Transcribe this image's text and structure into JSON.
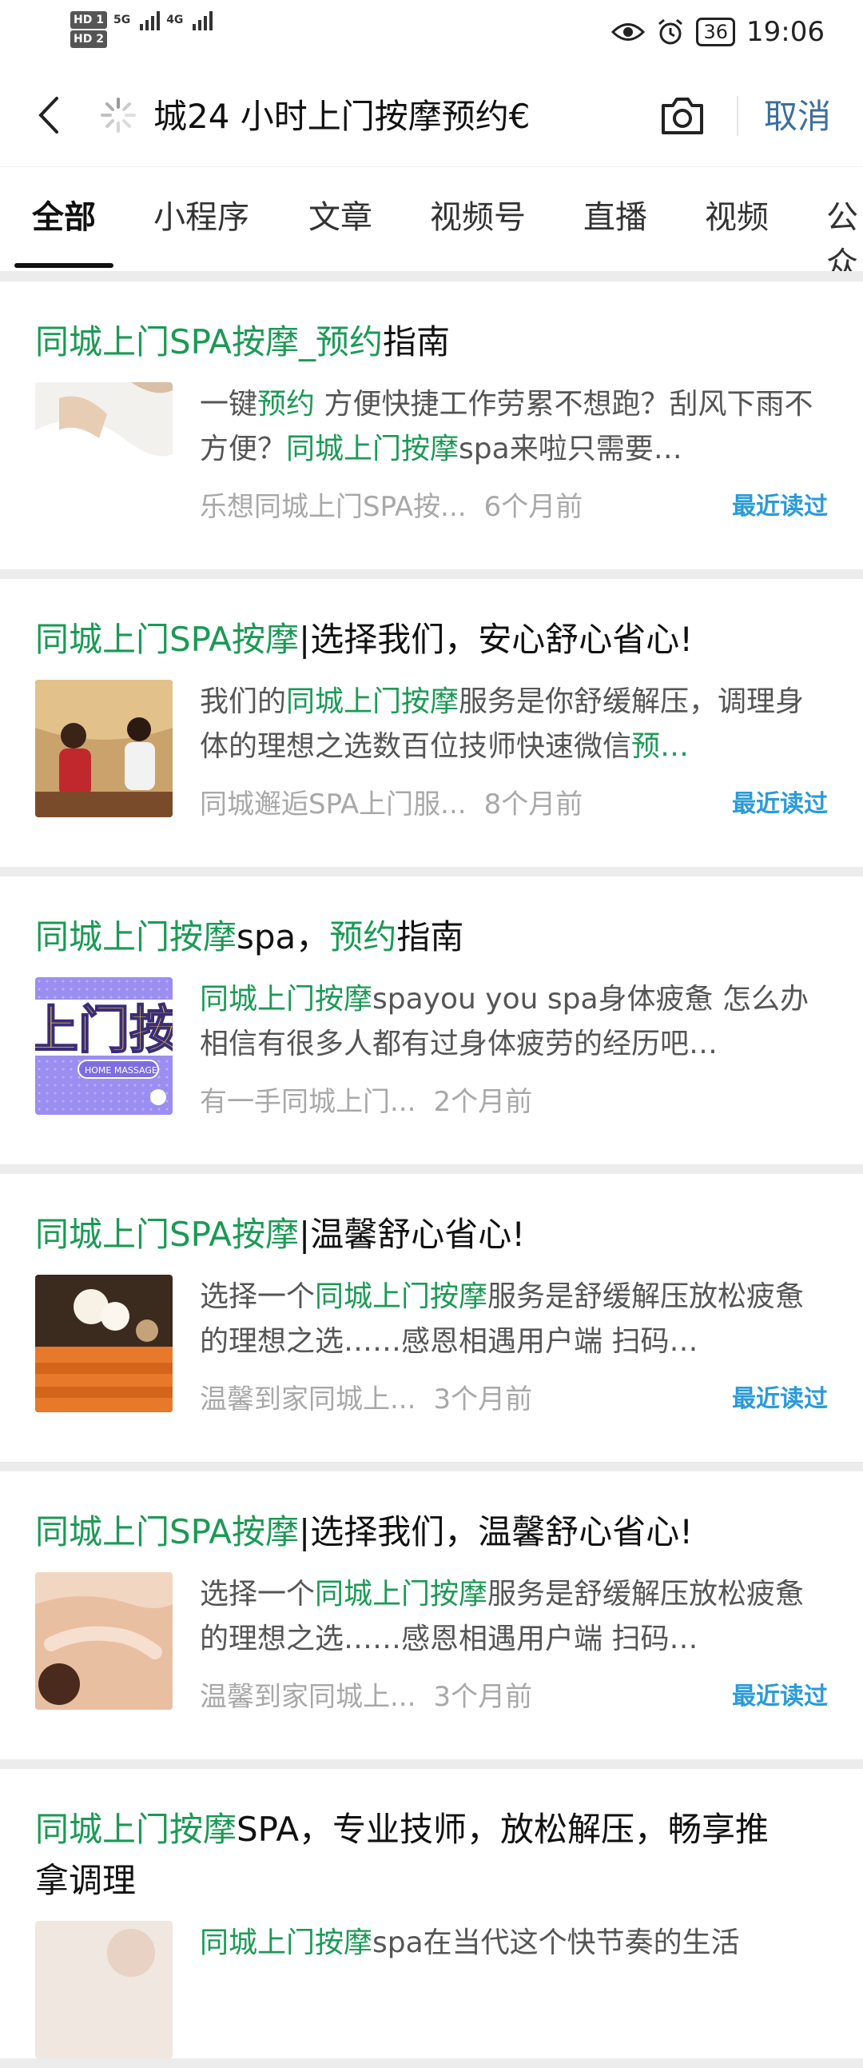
{
  "status": {
    "hd1": "HD 1",
    "hd2": "HD 2",
    "net5g": "5G",
    "net4g": "4G",
    "battery": "36",
    "time": "19:06"
  },
  "search": {
    "query": "城24 小时上门按摩预约€",
    "cancel_label": "取消"
  },
  "tabs": [
    "全部",
    "小程序",
    "文章",
    "视频号",
    "直播",
    "视频",
    "公众号"
  ],
  "recent_label": "最近读过",
  "results": [
    {
      "title": [
        {
          "t": "同城上门SPA按摩_预约",
          "hl": true
        },
        {
          "t": "指南",
          "hl": false
        }
      ],
      "snippet": [
        {
          "t": "一键",
          "hl": false
        },
        {
          "t": "预约",
          "hl": true
        },
        {
          "t": " 方便快捷工作劳累不想跑？刮风下雨不方便？",
          "hl": false
        },
        {
          "t": "同城上门按摩",
          "hl": true
        },
        {
          "t": "spa来啦只需要…",
          "hl": false
        }
      ],
      "source": "乐想同城上门SPA按...",
      "time": "6个月前",
      "recent": true
    },
    {
      "title": [
        {
          "t": "同城上门SPA按摩",
          "hl": true
        },
        {
          "t": "|选择我们，安心舒心省心!",
          "hl": false
        }
      ],
      "snippet": [
        {
          "t": "我们的",
          "hl": false
        },
        {
          "t": "同城上门按摩",
          "hl": true
        },
        {
          "t": "服务是你舒缓解压，调理身体的理想之选数百位技师快速微信",
          "hl": false
        },
        {
          "t": "预…",
          "hl": true
        }
      ],
      "source": "同城邂逅SPA上门服...",
      "time": "8个月前",
      "recent": true
    },
    {
      "title": [
        {
          "t": "同城上门按摩",
          "hl": true
        },
        {
          "t": "spa，",
          "hl": false
        },
        {
          "t": "预约",
          "hl": true
        },
        {
          "t": "指南",
          "hl": false
        }
      ],
      "snippet": [
        {
          "t": "同城上门按摩",
          "hl": true
        },
        {
          "t": "spayou you spa身体疲惫 怎么办相信有很多人都有过身体疲劳的经历吧…",
          "hl": false
        }
      ],
      "source": "有一手同城上门...",
      "time": "2个月前",
      "recent": false
    },
    {
      "title": [
        {
          "t": "同城上门SPA按摩",
          "hl": true
        },
        {
          "t": "|温馨舒心省心!",
          "hl": false
        }
      ],
      "snippet": [
        {
          "t": "选择一个",
          "hl": false
        },
        {
          "t": "同城上门按摩",
          "hl": true
        },
        {
          "t": "服务是舒缓解压放松疲惫的理想之选……感恩相遇用户端 扫码…",
          "hl": false
        }
      ],
      "source": "温馨到家同城上...",
      "time": "3个月前",
      "recent": true
    },
    {
      "title": [
        {
          "t": "同城上门SPA按摩",
          "hl": true
        },
        {
          "t": "|选择我们，温馨舒心省心!",
          "hl": false
        }
      ],
      "snippet": [
        {
          "t": "选择一个",
          "hl": false
        },
        {
          "t": "同城上门按摩",
          "hl": true
        },
        {
          "t": "服务是舒缓解压放松疲惫的理想之选……感恩相遇用户端 扫码…",
          "hl": false
        }
      ],
      "source": "温馨到家同城上...",
      "time": "3个月前",
      "recent": true
    },
    {
      "title": [
        {
          "t": "同城上门按摩",
          "hl": true
        },
        {
          "t": "SPA，专业技师，放松解压，畅享推拿调理",
          "hl": false
        }
      ],
      "snippet": [
        {
          "t": "同城上门按摩",
          "hl": true
        },
        {
          "t": "spa在当代这个快节奏的生活",
          "hl": false
        }
      ],
      "source": "",
      "time": "",
      "recent": false
    }
  ],
  "thumb_3_text": {
    "big": "上门按(",
    "sub": "HOME MASSAGE"
  },
  "colors": {
    "highlight": "#1a9a55",
    "recent": "#2a9bd9",
    "cancel": "#3c6f9a"
  }
}
